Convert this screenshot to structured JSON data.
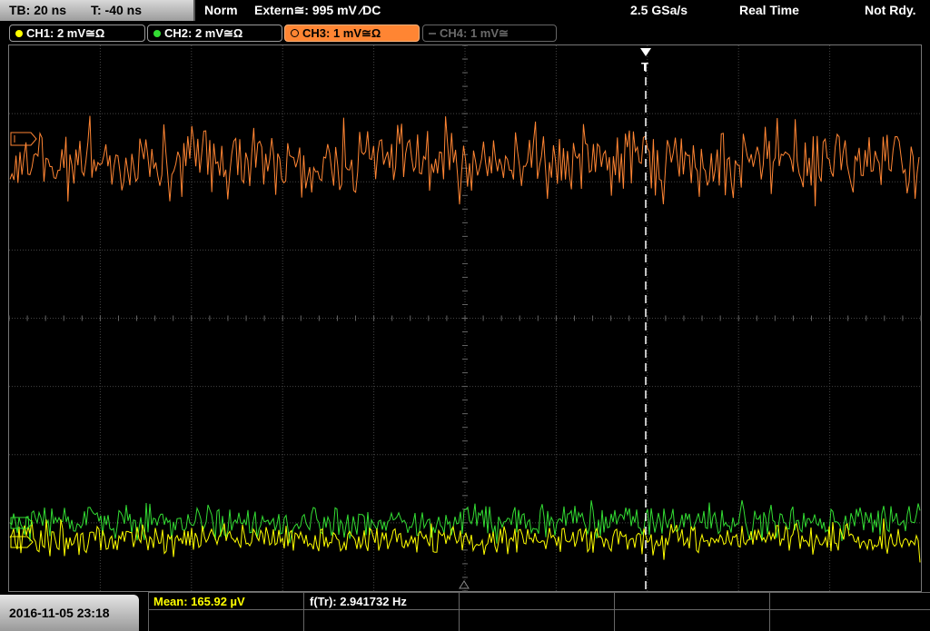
{
  "status_bar": {
    "timebase": "TB: 20 ns",
    "trigger_time": "T: -40 ns",
    "mode": "Norm",
    "trigger_source": "Extern≅: 995 mV ⁄DC",
    "sample_rate": "2.5 GSa/s",
    "acq_mode": "Real Time",
    "state": "Not Rdy."
  },
  "channels": [
    {
      "label": "CH1: 2 mV≅Ω",
      "color": "#ffff00",
      "active": true
    },
    {
      "label": "CH2: 2 mV≅Ω",
      "color": "#33dd33",
      "active": true
    },
    {
      "label": "CH3: 1 mV≅Ω",
      "color": "#ff8533",
      "active": true,
      "selected": true
    },
    {
      "label": "CH4: 1 mV≅",
      "color": "#707070",
      "active": false
    }
  ],
  "trigger_marker": "T",
  "measurements": {
    "mean_label": "Mean: 165.92 µV",
    "freq_label": "f(Tr): 2.941732 Hz"
  },
  "datetime": "2016-11-05 23:18",
  "colors": {
    "ch1": "#ffff00",
    "ch2": "#33dd33",
    "ch3": "#ff8533",
    "grid": "#444444",
    "background": "#000000"
  }
}
